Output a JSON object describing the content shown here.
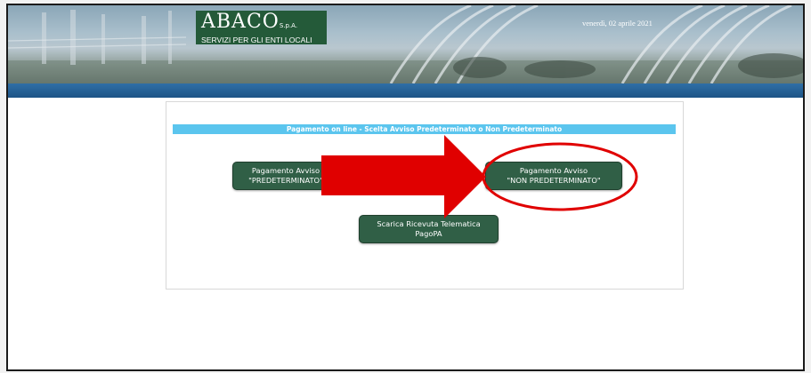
{
  "header": {
    "logo_title": "ABACO",
    "logo_suffix": "S.p.A.",
    "logo_subtitle": "SERVIZI PER GLI ENTI LOCALI",
    "date": "venerdì, 02 aprile 2021"
  },
  "panel": {
    "title": "Pagamento on line - Scelta Avviso Predeterminato o Non Predeterminato",
    "buttons": {
      "predeterminato": {
        "line1": "Pagamento Avviso",
        "line2": "\"PREDETERMINATO\""
      },
      "non_predeterminato": {
        "line1": "Pagamento Avviso",
        "line2": "\"NON PREDETERMINATO\""
      },
      "ricevuta": {
        "line1": "Scarica Ricevuta Telematica",
        "line2": "PagoPA"
      }
    }
  },
  "colors": {
    "title_bar": "#5bc5ee",
    "button": "#305f46",
    "annotation": "#e00000",
    "header_stripe": "#245f93"
  },
  "annotations": {
    "arrow": "red-arrow",
    "highlight": "red-ellipse"
  }
}
